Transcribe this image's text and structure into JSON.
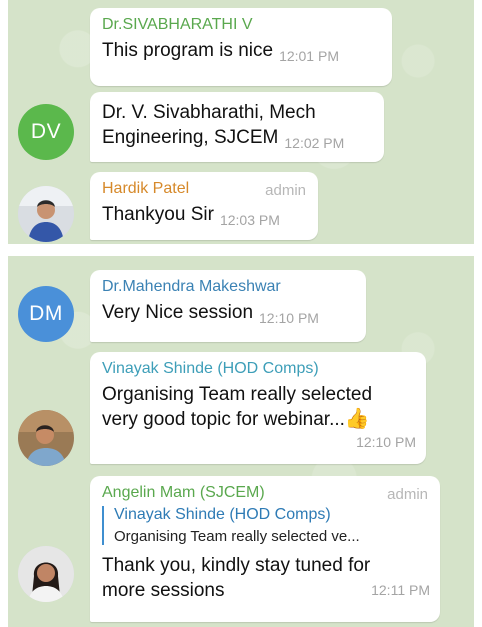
{
  "colors": {
    "avatar_dv": "#5bb84c",
    "avatar_dm": "#4a90d9",
    "name_green": "#5aa84e",
    "name_orange": "#d6892a",
    "name_blue": "#3b82b4",
    "name_teal": "#3d9eb8",
    "admin_tag": "#b7b7b7"
  },
  "messages_top": [
    {
      "sender": "Dr.SIVABHARATHI V",
      "text": "This program is nice",
      "time": "12:01 PM"
    },
    {
      "avatar_initials": "DV",
      "text": "Dr. V. Sivabharathi, Mech Engineering, SJCEM",
      "line1": "Dr. V. Sivabharathi, Mech",
      "line2": "Engineering, SJCEM",
      "time": "12:02 PM"
    },
    {
      "sender": "Hardik Patel",
      "tag": "admin",
      "text": "Thankyou Sir",
      "time": "12:03 PM"
    }
  ],
  "messages_bottom": [
    {
      "avatar_initials": "DM",
      "sender": "Dr.Mahendra Makeshwar",
      "text": "Very Nice session",
      "time": "12:10 PM"
    },
    {
      "sender": "Vinayak Shinde (HOD Comps)",
      "line1": "Organising Team really selected",
      "line2": "very good topic for webinar...",
      "emoji": "👍",
      "time": "12:10 PM"
    },
    {
      "sender": "Angelin Mam (SJCEM)",
      "tag": "admin",
      "reply_sender": "Vinayak Shinde (HOD Comps)",
      "reply_text": "Organising Team really selected ve...",
      "line1": "Thank you,  kindly stay tuned for",
      "line2": "more sessions",
      "time": "12:11 PM"
    }
  ]
}
